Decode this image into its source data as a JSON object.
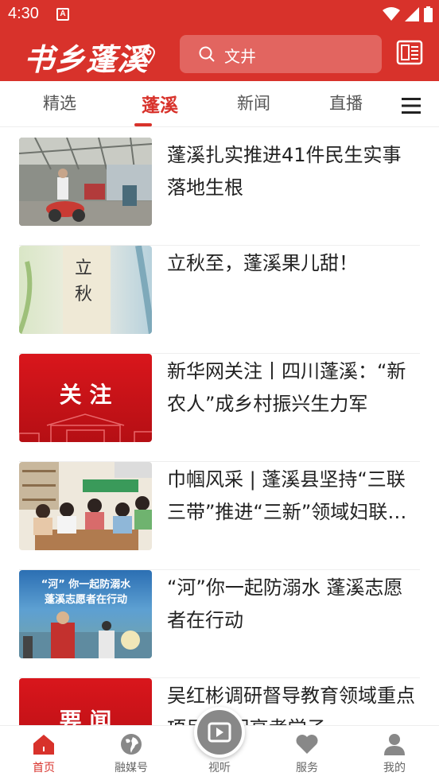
{
  "status_bar": {
    "time": "4:30",
    "notification_icon": "a-icon"
  },
  "header": {
    "logo_text": "书乡蓬溪",
    "search_placeholder": "文井",
    "accent_color": "#d8322b"
  },
  "tabs": [
    {
      "label": "精选",
      "active": false
    },
    {
      "label": "蓬溪",
      "active": true
    },
    {
      "label": "新闻",
      "active": false
    },
    {
      "label": "直播",
      "active": false
    }
  ],
  "news": [
    {
      "title": "蓬溪扎实推进41件民生实事落地生根",
      "thumb": "street-photo"
    },
    {
      "title": "立秋至，蓬溪果儿甜！",
      "thumb": "liqiu-photo",
      "thumb_text": "立\n秋"
    },
    {
      "title": "新华网关注丨四川蓬溪：“新农人”成乡村振兴生力军",
      "thumb": "guanzhu-banner",
      "thumb_text": "关 注"
    },
    {
      "title": "巾帼风采 | 蓬溪县坚持“三联三带”推进“三新”领域妇联组…",
      "thumb": "meeting-photo"
    },
    {
      "title": "“河”你一起防溺水 蓬溪志愿者在行动",
      "thumb": "river-photo",
      "thumb_text_1": "“河” 你一起防溺水",
      "thumb_text_2": "蓬溪志愿者在行动"
    },
    {
      "title": "吴红彬调研督导教育领域重点项目 慰问高考学子",
      "thumb": "yaowen-banner",
      "thumb_text": "要 闻"
    }
  ],
  "bottom_nav": [
    {
      "label": "首页",
      "icon": "home-icon",
      "active": true
    },
    {
      "label": "融媒号",
      "icon": "globe-icon",
      "active": false
    },
    {
      "label": "视听",
      "icon": "video-icon",
      "active": false
    },
    {
      "label": "服务",
      "icon": "heart-icon",
      "active": false
    },
    {
      "label": "我的",
      "icon": "user-icon",
      "active": false
    }
  ]
}
